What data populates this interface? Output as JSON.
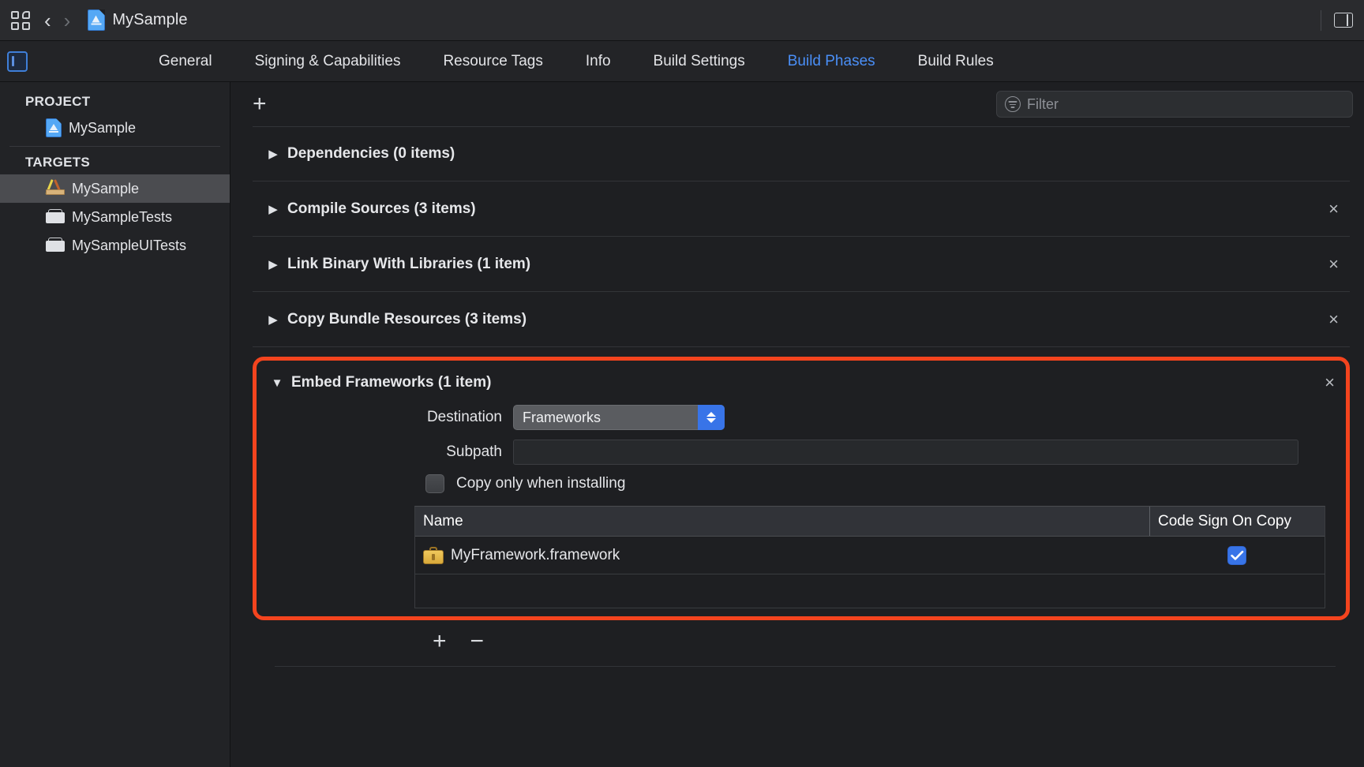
{
  "toolbar": {
    "grid_icon": "grid-squares-icon",
    "back_icon": "chevron-left-icon",
    "forward_icon": "chevron-right-icon",
    "document_icon": "xcode-project-icon",
    "document_title": "MySample",
    "inspector_panel_icon": "right-panel-toggle-icon"
  },
  "tabbar": {
    "navigator_toggle_icon": "left-panel-toggle-icon",
    "active_tab": "Build Phases",
    "accent_color": "#4a8ff7",
    "tabs": [
      {
        "label": "General"
      },
      {
        "label": "Signing & Capabilities"
      },
      {
        "label": "Resource Tags"
      },
      {
        "label": "Info"
      },
      {
        "label": "Build Settings"
      },
      {
        "label": "Build Phases"
      },
      {
        "label": "Build Rules"
      }
    ]
  },
  "sidebar": {
    "project_header": "PROJECT",
    "targets_header": "TARGETS",
    "project_items": [
      {
        "label": "MySample",
        "icon": "xcode-project-icon"
      }
    ],
    "target_items": [
      {
        "label": "MySample",
        "icon": "app-target-icon",
        "selected": true
      },
      {
        "label": "MySampleTests",
        "icon": "test-target-icon",
        "selected": false
      },
      {
        "label": "MySampleUITests",
        "icon": "test-target-icon",
        "selected": false
      }
    ]
  },
  "phase_toolbar": {
    "add_icon": "plus-icon",
    "filter": {
      "icon": "filter-icon",
      "placeholder": "Filter",
      "value": ""
    }
  },
  "phases": [
    {
      "title": "Dependencies (0 items)",
      "expanded": false,
      "removable": false
    },
    {
      "title": "Compile Sources (3 items)",
      "expanded": false,
      "removable": true
    },
    {
      "title": "Link Binary With Libraries (1 item)",
      "expanded": false,
      "removable": true
    },
    {
      "title": "Copy Bundle Resources (3 items)",
      "expanded": false,
      "removable": true
    }
  ],
  "embed_frameworks": {
    "title": "Embed Frameworks (1 item)",
    "expanded": true,
    "highlight_color": "#f4441e",
    "remove_icon": "close-icon",
    "destination": {
      "label": "Destination",
      "value": "Frameworks",
      "stepper_icon": "chevron-up-down-icon"
    },
    "subpath": {
      "label": "Subpath",
      "value": "",
      "placeholder": ""
    },
    "copy_only": {
      "label": "Copy only when installing",
      "checked": false
    },
    "table": {
      "columns": [
        "Name",
        "Code Sign On Copy"
      ],
      "rows": [
        {
          "name": "MyFramework.framework",
          "icon": "framework-toolbox-icon",
          "code_sign_on_copy": true
        }
      ]
    },
    "add_icon": "plus-icon",
    "remove_item_icon": "minus-icon"
  },
  "row_remove_icon": "close-icon",
  "disclosure_collapsed_glyph": "▶",
  "disclosure_expanded_glyph": "▼",
  "close_glyph": "×",
  "plus_glyph": "+",
  "minus_glyph": "−"
}
